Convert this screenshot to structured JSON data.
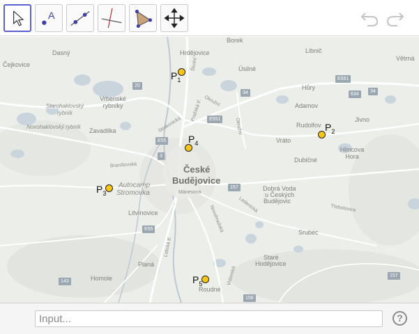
{
  "toolbar": {
    "tools": [
      {
        "name": "Move"
      },
      {
        "name": "Point",
        "glyph": "A"
      },
      {
        "name": "Line"
      },
      {
        "name": "Perpendicular Line"
      },
      {
        "name": "Polygon"
      },
      {
        "name": "Move Graphics View"
      }
    ],
    "undo_icon": "undo-icon",
    "redo_icon": "redo-icon"
  },
  "map": {
    "places": {
      "cejkovice": "Čejkovice",
      "dasny": "Dasný",
      "hrdejovice": "Hrdějovice",
      "borek": "Borek",
      "libnic": "Libnič",
      "vetrna": "Větrná",
      "usilne": "Úsilné",
      "hury": "Hůry",
      "adamov": "Adamov",
      "rudolfov": "Rudolfov",
      "jivno": "Jivno",
      "vrato": "Vráto",
      "hlincova": "Hlincova Hora",
      "dubicne": "Dubičné",
      "vrbenske": "Vrbenské rybníky",
      "starohaklovsky": "Starohaklovský rybník",
      "novohaklovsky": "Novohaklovský rybník",
      "zavadilka": "Zavadilka",
      "cb1": "České",
      "cb2": "Budějovice",
      "autocamp1": "Autocamp",
      "autocamp2": "Stromovka",
      "litvinovice": "Litvínovice",
      "dobra1": "Dobrá Voda",
      "dobra2": "u Českých",
      "dobra3": "Budějovic",
      "srubec": "Srubec",
      "stare1": "Staré",
      "stare2": "Hodějovice",
      "homole": "Homole",
      "plana": "Planá",
      "roudne": "Roudné"
    },
    "streets": {
      "skolni": "Školní",
      "prazska": "Pražská tř.",
      "okruzni": "Okružní",
      "okruzni2": "Okružní",
      "strakonicka": "Strakonická",
      "branisovska": "Branišovská",
      "manesova": "Mánesova",
      "lidicka": "Lidická tř.",
      "novohradska": "Novohradská",
      "ledenicka": "Ledenická",
      "trebotovice": "Třebotovice",
      "vidovska": "Vidovská"
    },
    "shields": {
      "r20": "20",
      "r34a": "34",
      "e551a": "E551",
      "r634": "634",
      "r34b": "34",
      "e551b": "E551",
      "e55a": "E55",
      "r3": "3",
      "r157a": "157",
      "e55b": "E55",
      "r143": "143",
      "r157b": "157",
      "r156": "156"
    },
    "points": [
      {
        "base": "P",
        "index": "1"
      },
      {
        "base": "P",
        "index": "2"
      },
      {
        "base": "P",
        "index": "3"
      },
      {
        "base": "P",
        "index": "4"
      },
      {
        "base": "P",
        "index": "5"
      }
    ],
    "colors": {
      "point_fill": "#f5c518",
      "water": "#c9d4dd",
      "road": "#ffffff"
    }
  },
  "input_bar": {
    "placeholder": "Input...",
    "value": "",
    "help_label": "?"
  }
}
